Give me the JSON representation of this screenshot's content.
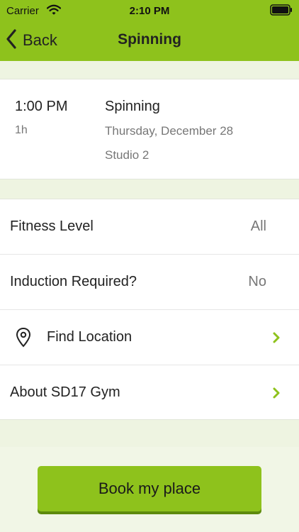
{
  "status_bar": {
    "carrier": "Carrier",
    "time": "2:10 PM"
  },
  "nav": {
    "back_label": "Back",
    "title": "Spinning"
  },
  "session": {
    "time": "1:00 PM",
    "duration": "1h",
    "name": "Spinning",
    "date": "Thursday, December 28",
    "studio": "Studio 2"
  },
  "details": {
    "fitness_level": {
      "label": "Fitness Level",
      "value": "All"
    },
    "induction": {
      "label": "Induction Required?",
      "value": "No"
    },
    "find_location": {
      "label": "Find Location"
    },
    "about": {
      "label": "About SD17 Gym"
    }
  },
  "actions": {
    "book_label": "Book my place"
  },
  "colors": {
    "accent": "#8ec21c",
    "background": "#eef4e1"
  }
}
